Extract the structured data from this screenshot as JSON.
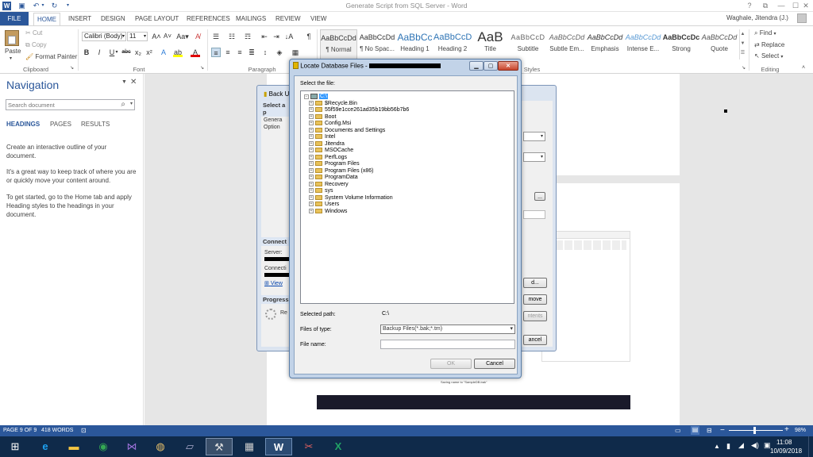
{
  "window": {
    "title": "Generate Script from SQL Server - Word",
    "controls": {
      "help": "?",
      "restore": "⧉",
      "minimize": "—",
      "maximize": "☐",
      "close": "✕"
    },
    "user": "Waghale, Jitendra (J.)"
  },
  "tabs": [
    "FILE",
    "HOME",
    "INSERT",
    "DESIGN",
    "PAGE LAYOUT",
    "REFERENCES",
    "MAILINGS",
    "REVIEW",
    "VIEW"
  ],
  "clipboard": {
    "paste": "Paste",
    "cut": "Cut",
    "copy": "Copy",
    "format_painter": "Format Painter",
    "label": "Clipboard"
  },
  "font": {
    "name": "Calibri (Body)",
    "size": "11",
    "label": "Font"
  },
  "paragraph": {
    "label": "Paragraph"
  },
  "styles": {
    "label": "Styles",
    "items": [
      {
        "preview": "AaBbCcDd",
        "name": "¶ Normal"
      },
      {
        "preview": "AaBbCcDd",
        "name": "¶ No Spac..."
      },
      {
        "preview": "AaBbCc",
        "name": "Heading 1"
      },
      {
        "preview": "AaBbCcD",
        "name": "Heading 2"
      },
      {
        "preview": "AaB",
        "name": "Title"
      },
      {
        "preview": "AaBbCcD",
        "name": "Subtitle"
      },
      {
        "preview": "AaBbCcDd",
        "name": "Subtle Em..."
      },
      {
        "preview": "AaBbCcDd",
        "name": "Emphasis"
      },
      {
        "preview": "AaBbCcDd",
        "name": "Intense E..."
      },
      {
        "preview": "AaBbCcDc",
        "name": "Strong"
      },
      {
        "preview": "AaBbCcDd",
        "name": "Quote"
      }
    ]
  },
  "editing": {
    "find": "Find",
    "replace": "Replace",
    "select": "Select",
    "label": "Editing"
  },
  "navigation": {
    "title": "Navigation",
    "search_placeholder": "Search document",
    "tabs": [
      "HEADINGS",
      "PAGES",
      "RESULTS"
    ],
    "p1": "Create an interactive outline of your document.",
    "p2": "It's a great way to keep track of where you are or quickly move your content around.",
    "p3": "To get started, go to the Home tab and apply Heading styles to the headings in your document."
  },
  "backup_dialog": {
    "title": "Back U",
    "select_page": "Select a p",
    "pages": [
      "Genera",
      "Option"
    ],
    "connection": "Connect",
    "server": "Server:",
    "connection_label": "Connecti",
    "view_link": "View",
    "progress": "Progress",
    "ready": "Re",
    "add_btn": "d...",
    "remove_btn": "move",
    "contents_btn": "ntents",
    "cancel_btn": "ancel"
  },
  "locate_dialog": {
    "title": "Locate Database Files - ",
    "select_file": "Select the file:",
    "root": "C:\\",
    "folders": [
      "$Recycle.Bin",
      "55f59e1cce261ad35b19bb56b7b6",
      "Boot",
      "Config.Msi",
      "Documents and Settings",
      "Intel",
      "Jitendra",
      "MSOCache",
      "PerfLogs",
      "Program Files",
      "Program Files (x86)",
      "ProgramData",
      "Recovery",
      "sys",
      "System Volume Information",
      "Users",
      "Windows"
    ],
    "selected_path_label": "Selected path:",
    "selected_path": "C:\\",
    "files_of_type_label": "Files of type:",
    "files_of_type": "Backup Files(*.bak;*.tm)",
    "file_name_label": "File name:",
    "file_name": "",
    "ok": "OK",
    "cancel": "Cancel"
  },
  "status": {
    "page": "PAGE 9 OF 9",
    "words": "418 WORDS",
    "zoom": "98%",
    "zoom_minus": "−",
    "zoom_plus": "+"
  },
  "doc_caption": "Saving name to \"SampleDB.bak\"",
  "taskbar": {
    "time": "11:08",
    "date": "10/09/2018"
  },
  "colors": {
    "accent": "#2b579a",
    "taskbar": "#0f2a4a"
  }
}
